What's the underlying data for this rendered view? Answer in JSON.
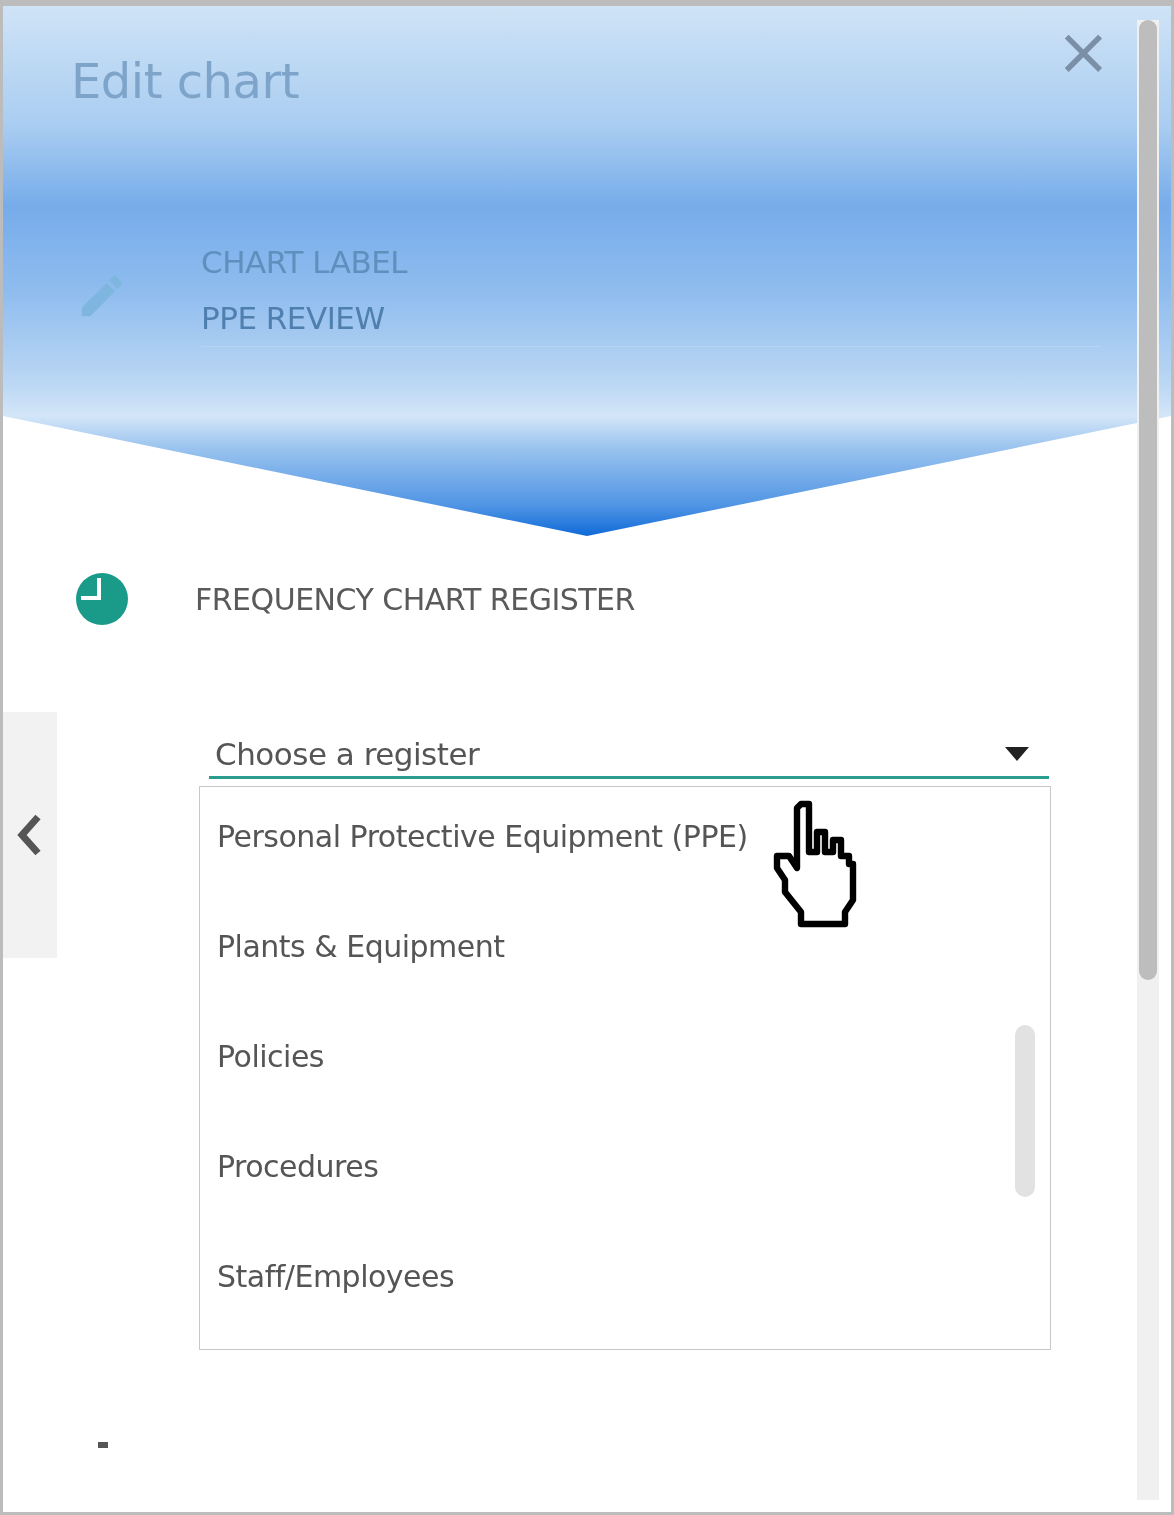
{
  "dialog": {
    "title": "Edit chart",
    "close": "×"
  },
  "chart_label": {
    "label": "CHART LABEL",
    "value": "PPE REVIEW"
  },
  "section": {
    "title": "FREQUENCY CHART REGISTER"
  },
  "register_select": {
    "placeholder": "Choose a register",
    "options": [
      {
        "label": "Personal Protective Equipment (PPE)"
      },
      {
        "label": "Plants & Equipment"
      },
      {
        "label": "Policies"
      },
      {
        "label": "Procedures"
      },
      {
        "label": "Staff/Employees"
      }
    ]
  }
}
